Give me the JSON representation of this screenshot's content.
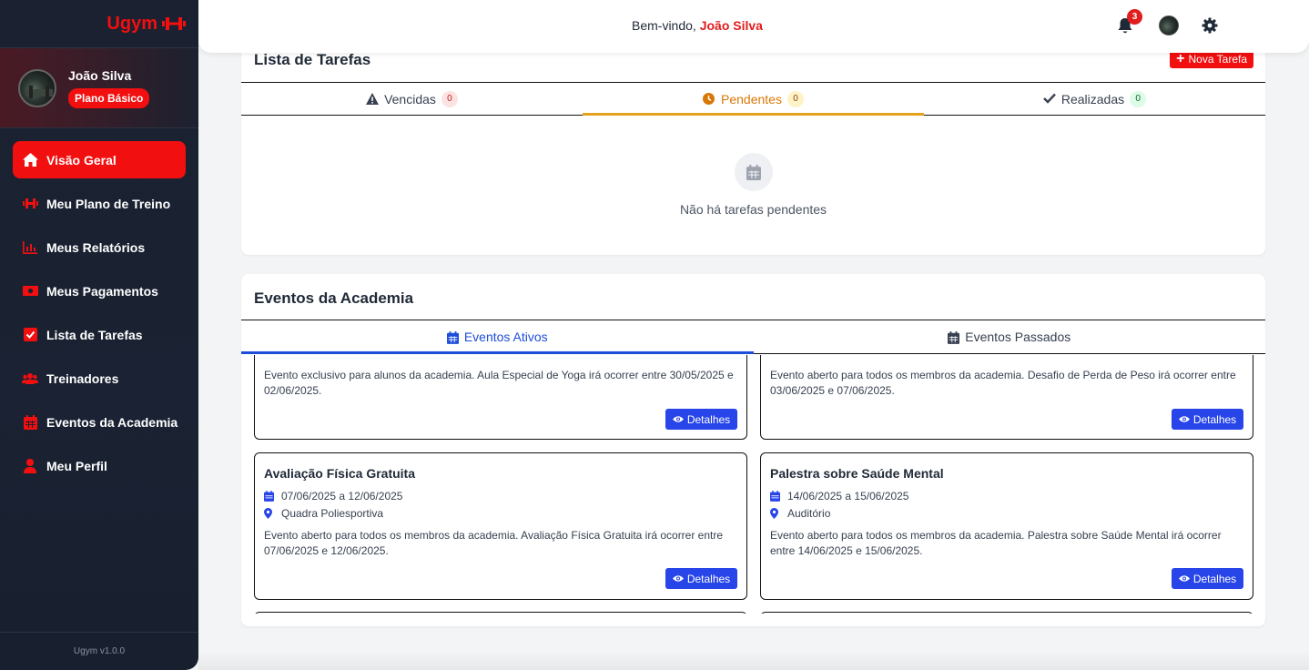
{
  "app": {
    "brand": "Ugym",
    "version": "Ugym v1.0.0"
  },
  "user": {
    "name": "João Silva",
    "plan": "Plano Básico"
  },
  "sidebar": {
    "items": [
      {
        "label": "Visão Geral",
        "icon": "home-icon",
        "active": true
      },
      {
        "label": "Meu Plano de Treino",
        "icon": "dumbbell-icon",
        "active": false
      },
      {
        "label": "Meus Relatórios",
        "icon": "chart-bar-icon",
        "active": false
      },
      {
        "label": "Meus Pagamentos",
        "icon": "money-icon",
        "active": false
      },
      {
        "label": "Lista de Tarefas",
        "icon": "check-square-icon",
        "active": false
      },
      {
        "label": "Treinadores",
        "icon": "users-icon",
        "active": false
      },
      {
        "label": "Eventos da Academia",
        "icon": "calendar-icon",
        "active": false
      },
      {
        "label": "Meu Perfil",
        "icon": "user-icon",
        "active": false
      }
    ]
  },
  "header": {
    "welcome_prefix": "Bem-vindo,",
    "username": "João Silva",
    "notifications_count": "3"
  },
  "tasks": {
    "title": "Lista de Tarefas",
    "new_task_label": "Nova Tarefa",
    "tabs": [
      {
        "label": "Vencidas",
        "count": "0",
        "icon": "warning-icon"
      },
      {
        "label": "Pendentes",
        "count": "0",
        "icon": "clock-icon",
        "active": true
      },
      {
        "label": "Realizadas",
        "count": "0",
        "icon": "check-icon"
      }
    ],
    "empty_message": "Não há tarefas pendentes"
  },
  "events": {
    "title": "Eventos da Academia",
    "tabs": [
      {
        "label": "Eventos Ativos",
        "active": true
      },
      {
        "label": "Eventos Passados"
      }
    ],
    "details_label": "Detalhes",
    "items": [
      {
        "desc": "Evento exclusivo para alunos da academia. Aula Especial de Yoga irá ocorrer entre 30/05/2025 e 02/06/2025."
      },
      {
        "desc": "Evento aberto para todos os membros da academia. Desafio de Perda de Peso irá ocorrer entre 03/06/2025 e 07/06/2025."
      },
      {
        "title": "Avaliação Física Gratuita",
        "dates": "07/06/2025 a 12/06/2025",
        "location": "Quadra Poliesportiva",
        "desc": "Evento aberto para todos os membros da academia. Avaliação Física Gratuita irá ocorrer entre 07/06/2025 e 12/06/2025."
      },
      {
        "title": "Palestra sobre Saúde Mental",
        "dates": "14/06/2025 a 15/06/2025",
        "location": "Auditório",
        "desc": "Evento aberto para todos os membros da academia. Palestra sobre Saúde Mental irá ocorrer entre 14/06/2025 e 15/06/2025."
      }
    ]
  },
  "colors": {
    "accent_red": "#f20f0f",
    "sidebar_bg": "#1b2130",
    "primary_blue": "#2745e8",
    "pending_orange": "#d97706"
  }
}
